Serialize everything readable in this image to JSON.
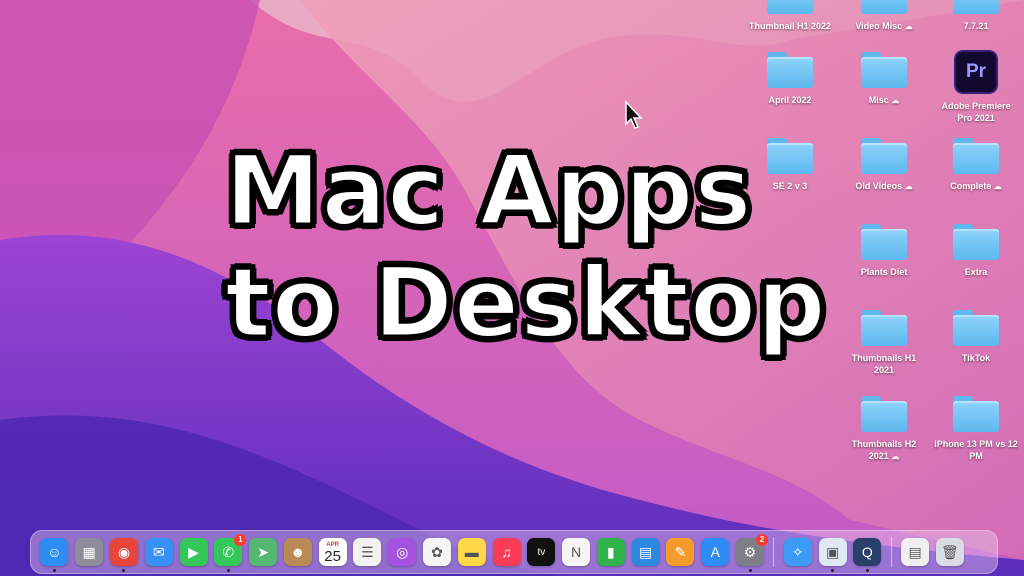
{
  "headline": {
    "line1": "Mac Apps",
    "line2": "to Desktop"
  },
  "desktop_items": [
    {
      "id": "thumbnail-h1-2022",
      "label": "Thumbnail H1 2022",
      "type": "folder",
      "cloud": false
    },
    {
      "id": "video-misc",
      "label": "Video Misc",
      "type": "folder",
      "cloud": true
    },
    {
      "id": "7-7-21",
      "label": "7.7.21",
      "type": "folder",
      "cloud": false
    },
    {
      "id": "april-2022",
      "label": "April 2022",
      "type": "folder",
      "cloud": false
    },
    {
      "id": "misc",
      "label": "Misc",
      "type": "folder",
      "cloud": true
    },
    {
      "id": "adobe-premiere",
      "label": "Adobe Premiere Pro 2021",
      "type": "app",
      "app_glyph": "Pr",
      "cloud": false
    },
    {
      "id": "se-2-v-3",
      "label": "SE 2 v 3",
      "type": "folder",
      "cloud": false
    },
    {
      "id": "old-videos",
      "label": "Old Videos",
      "type": "folder",
      "cloud": true
    },
    {
      "id": "complete",
      "label": "Complete",
      "type": "folder",
      "cloud": true
    },
    {
      "id": "plants-diet",
      "label": "Plants Diet",
      "type": "folder",
      "cloud": false
    },
    {
      "id": "extra",
      "label": "Extra",
      "type": "folder",
      "cloud": false
    },
    {
      "id": "thumbnails-h1-2021",
      "label": "Thumbnails H1 2021",
      "type": "folder",
      "cloud": false
    },
    {
      "id": "tiktok",
      "label": "TikTok",
      "type": "folder",
      "cloud": false
    },
    {
      "id": "thumbnails-h2-2021",
      "label": "Thumbnails H2 2021",
      "type": "folder",
      "cloud": true
    },
    {
      "id": "iphone-13-pm",
      "label": "iPhone 13 PM vs 12 PM",
      "type": "folder",
      "cloud": false
    }
  ],
  "cloud_glyph": "☁",
  "dock": {
    "calendar": {
      "month": "APR",
      "day": "25"
    },
    "apps": [
      {
        "name": "finder",
        "glyph": "☺",
        "color": "#2f8cf0",
        "running": true
      },
      {
        "name": "launchpad",
        "glyph": "▦",
        "color": "#8e8e9a",
        "running": false
      },
      {
        "name": "chrome",
        "glyph": "◉",
        "color": "#e8453c",
        "running": true
      },
      {
        "name": "mail",
        "glyph": "✉",
        "color": "#3a8ff5",
        "running": false
      },
      {
        "name": "facetime",
        "glyph": "▶",
        "color": "#34c759",
        "running": false
      },
      {
        "name": "messages",
        "glyph": "✆",
        "color": "#34c759",
        "running": true,
        "badge": "1"
      },
      {
        "name": "maps",
        "glyph": "➤",
        "color": "#54b872",
        "running": false
      },
      {
        "name": "contacts",
        "glyph": "☻",
        "color": "#b98a55",
        "running": false
      },
      {
        "name": "calendar",
        "glyph": "",
        "color": "#ffffff",
        "running": false
      },
      {
        "name": "reminders",
        "glyph": "☰",
        "color": "#f2f2f2",
        "running": false
      },
      {
        "name": "podcasts",
        "glyph": "◎",
        "color": "#a552e0",
        "running": false
      },
      {
        "name": "photos",
        "glyph": "✿",
        "color": "#f5f5f5",
        "running": false
      },
      {
        "name": "notes",
        "glyph": "▬",
        "color": "#ffd84a",
        "running": false
      },
      {
        "name": "music",
        "glyph": "♫",
        "color": "#fa3b55",
        "running": false
      },
      {
        "name": "tv",
        "glyph": "tv",
        "color": "#111111",
        "running": false
      },
      {
        "name": "news",
        "glyph": "N",
        "color": "#f5f5f5",
        "running": false
      },
      {
        "name": "numbers",
        "glyph": "▮",
        "color": "#2fb34a",
        "running": false
      },
      {
        "name": "keynote",
        "glyph": "▤",
        "color": "#2d88e0",
        "running": false
      },
      {
        "name": "pages",
        "glyph": "✎",
        "color": "#f39b2b",
        "running": false
      },
      {
        "name": "app-store",
        "glyph": "A",
        "color": "#2f8cf5",
        "running": false
      },
      {
        "name": "system-preferences",
        "glyph": "⚙",
        "color": "#7e7e86",
        "running": true,
        "badge": "2"
      }
    ],
    "apps2": [
      {
        "name": "safari",
        "glyph": "✧",
        "color": "#3c9cf5",
        "running": false
      },
      {
        "name": "preview",
        "glyph": "▣",
        "color": "#dfe9f5",
        "running": true
      },
      {
        "name": "quicktime",
        "glyph": "Q",
        "color": "#2b3f6b",
        "running": true
      }
    ],
    "apps3": [
      {
        "name": "documents",
        "glyph": "▤",
        "color": "#f0f0f0",
        "running": false
      },
      {
        "name": "trash",
        "glyph": "🗑",
        "color": "#d9dde3",
        "running": false
      }
    ]
  }
}
